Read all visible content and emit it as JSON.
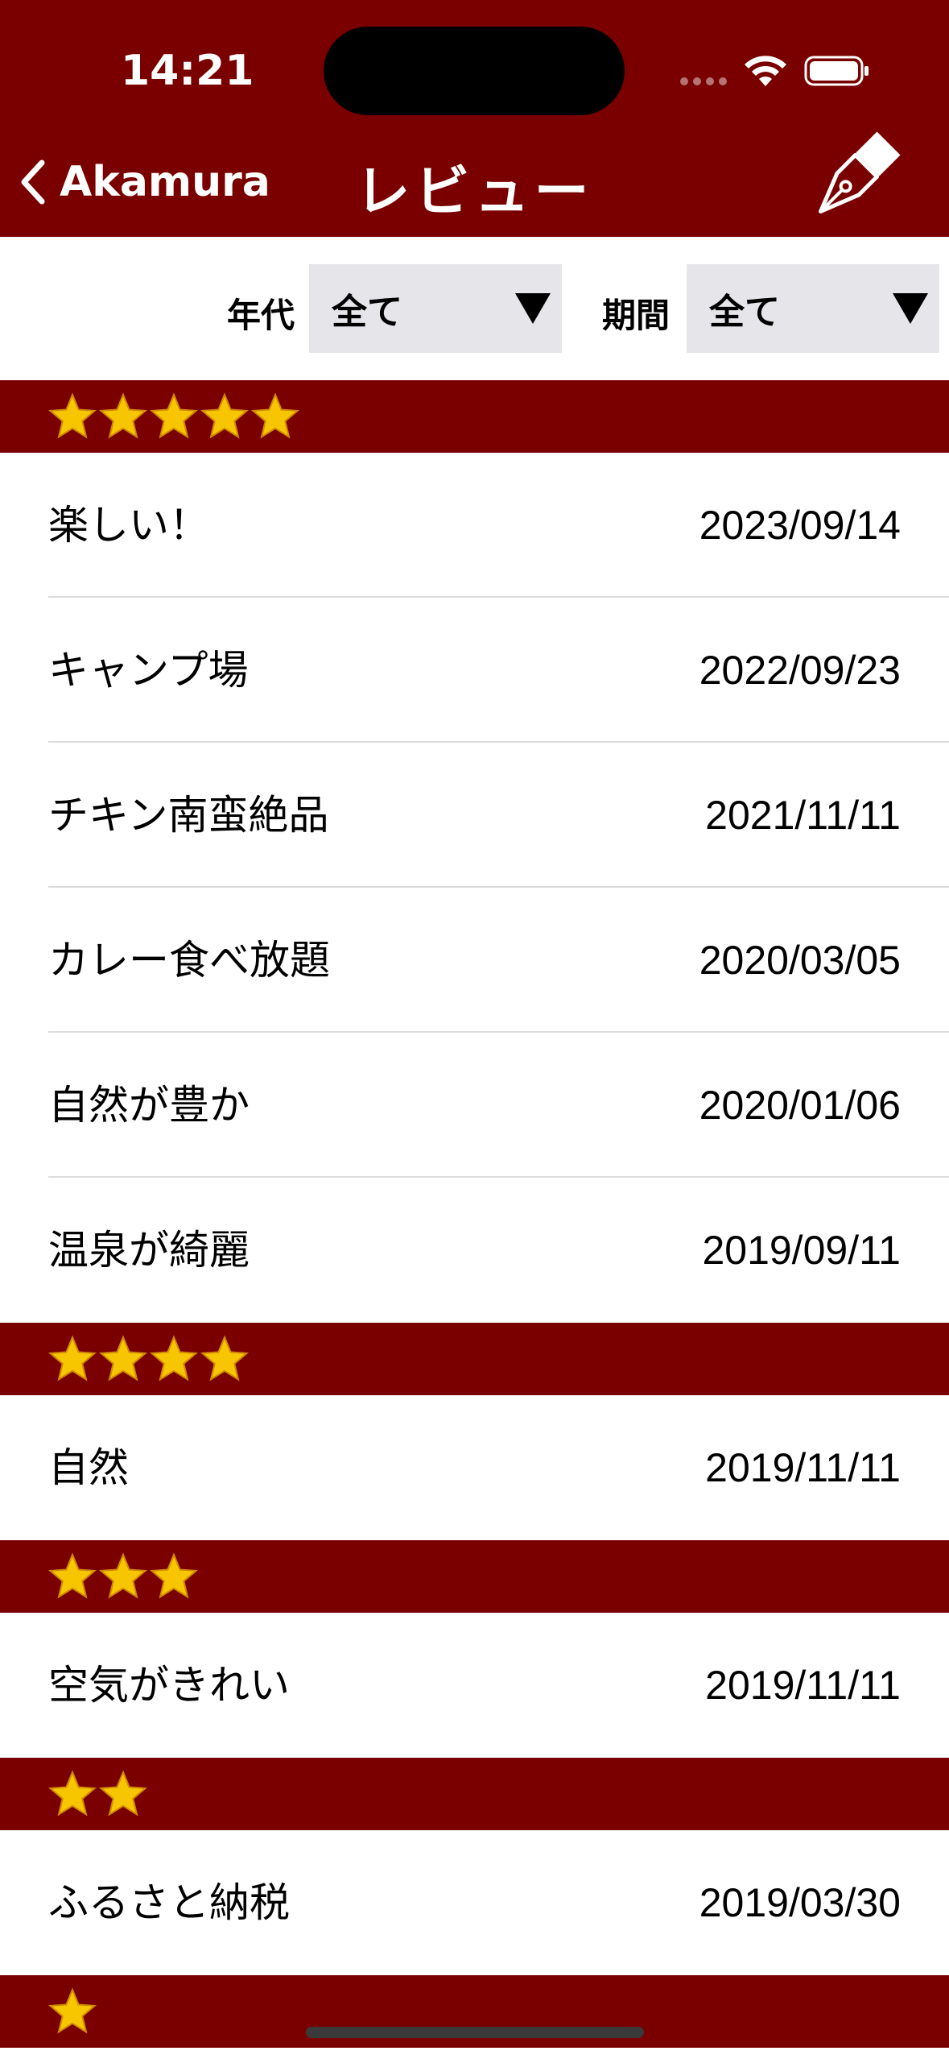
{
  "status_bar": {
    "time": "14:21"
  },
  "nav": {
    "back_label": "Akamura",
    "title": "レビュー",
    "write_icon": "pen-nib-icon"
  },
  "filters": {
    "age": {
      "label": "年代",
      "value": "全て"
    },
    "period": {
      "label": "期間",
      "value": "全て"
    }
  },
  "colors": {
    "accent": "#7a0000",
    "star": "#f7c600",
    "row_bg": "#ffffff",
    "select_bg": "#e5e5ea"
  },
  "sections": [
    {
      "stars": 5,
      "items": [
        {
          "title": "楽しい！",
          "date": "2023/09/14"
        },
        {
          "title": "キャンプ場",
          "date": "2022/09/23"
        },
        {
          "title": "チキン南蛮絶品",
          "date": "2021/11/11"
        },
        {
          "title": "カレー食べ放題",
          "date": "2020/03/05"
        },
        {
          "title": "自然が豊か",
          "date": "2020/01/06"
        },
        {
          "title": "温泉が綺麗",
          "date": "2019/09/11"
        }
      ]
    },
    {
      "stars": 4,
      "items": [
        {
          "title": "自然",
          "date": "2019/11/11"
        }
      ]
    },
    {
      "stars": 3,
      "items": [
        {
          "title": "空気がきれい",
          "date": "2019/11/11"
        }
      ]
    },
    {
      "stars": 2,
      "items": [
        {
          "title": "ふるさと納税",
          "date": "2019/03/30"
        }
      ]
    },
    {
      "stars": 1,
      "items": []
    }
  ]
}
